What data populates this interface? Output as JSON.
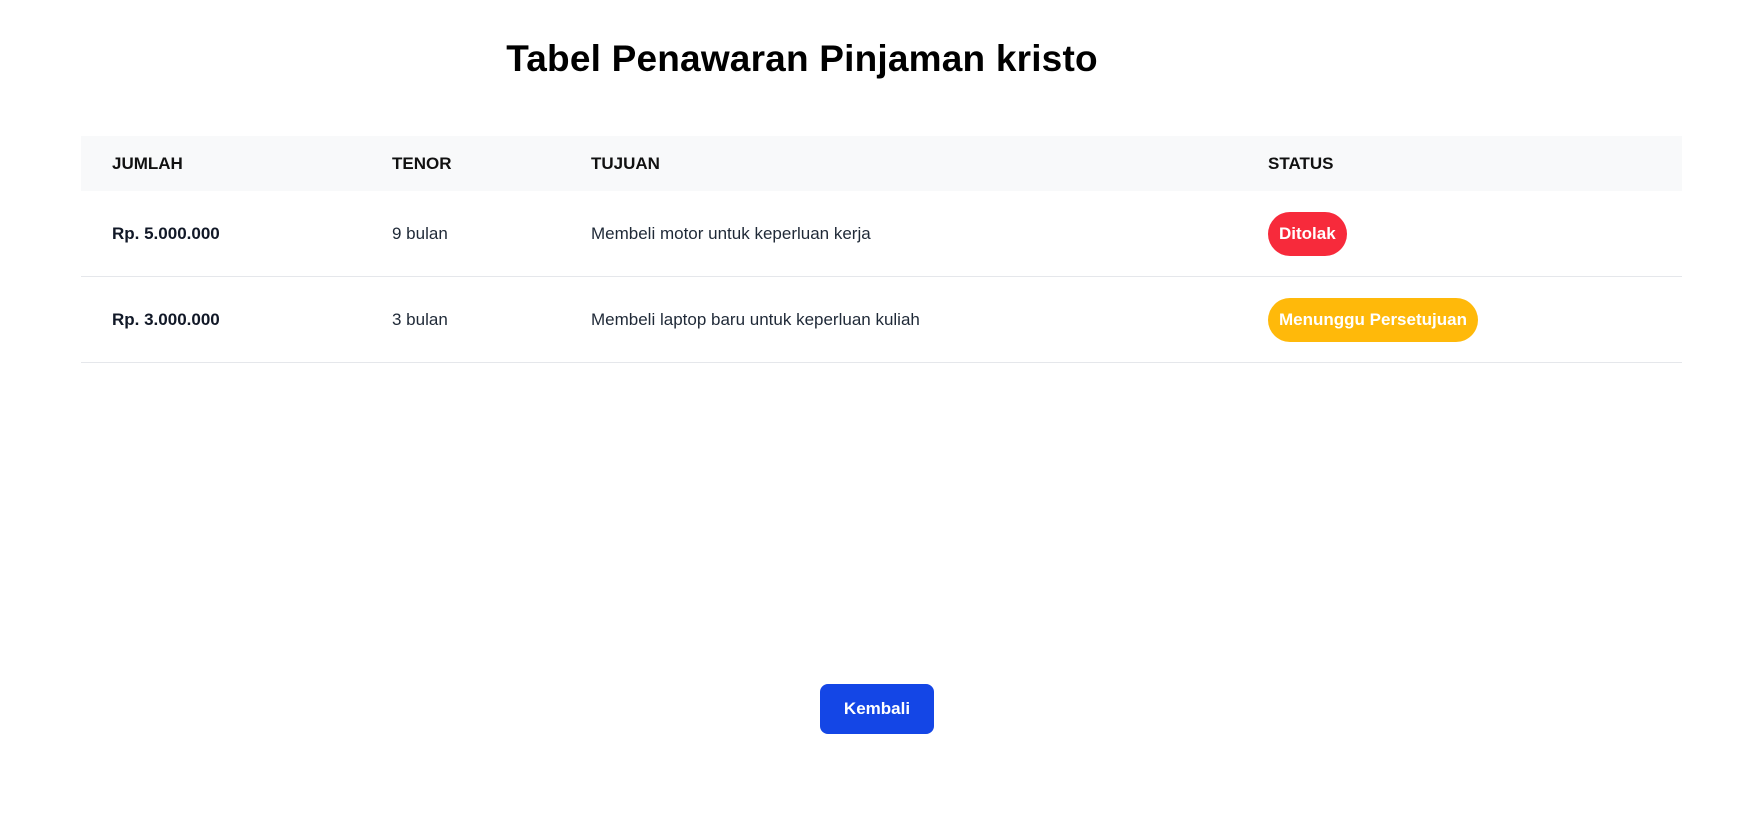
{
  "page": {
    "title": "Tabel Penawaran Pinjaman kristo"
  },
  "table": {
    "headers": {
      "amount": "JUMLAH",
      "tenor": "TENOR",
      "purpose": "TUJUAN",
      "status": "STATUS"
    },
    "rows": [
      {
        "amount": "Rp. 5.000.000",
        "tenor": "9 bulan",
        "purpose": "Membeli motor untuk keperluan kerja",
        "status": "Ditolak",
        "status_color": "#f72a3b"
      },
      {
        "amount": "Rp. 3.000.000",
        "tenor": "3 bulan",
        "purpose": "Membeli laptop baru untuk keperluan kuliah",
        "status": "Menunggu Persetujuan",
        "status_color": "#ffb90a"
      }
    ]
  },
  "actions": {
    "back_label": "Kembali",
    "back_color": "#1446e6"
  }
}
